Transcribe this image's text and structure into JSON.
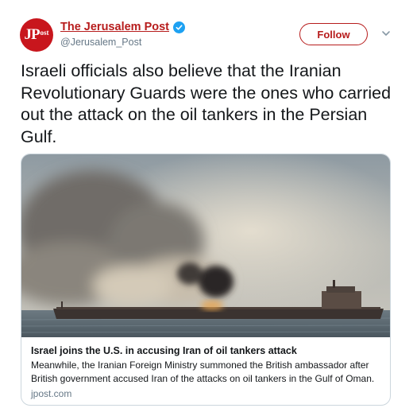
{
  "account": {
    "display_name": "The Jerusalem Post",
    "handle": "@Jerusalem_Post",
    "avatar_initials": "JP",
    "avatar_suffix": "ost",
    "verified": true,
    "brand_color": "#b71c1c"
  },
  "actions": {
    "follow_label": "Follow",
    "menu_icon": "chevron-down-icon"
  },
  "tweet": {
    "text": "Israeli officials also believe that the Iranian Revolutionary Guards were the ones who carried out the attack on the oil tankers in the Persian Gulf."
  },
  "card": {
    "title": "Israel joins the U.S. in accusing Iran of oil tankers attack",
    "description": "Meanwhile, the Iranian Foreign Ministry summoned the British ambassador after British government accused Iran of the attacks on oil tankers in the Gulf of Oman.",
    "domain": "jpost.com",
    "image_subject": "burning oil tanker at sea with smoke plume"
  },
  "colors": {
    "verified_badge": "#1da1f2",
    "secondary_text": "#657786",
    "card_border": "#ccd6dd"
  }
}
